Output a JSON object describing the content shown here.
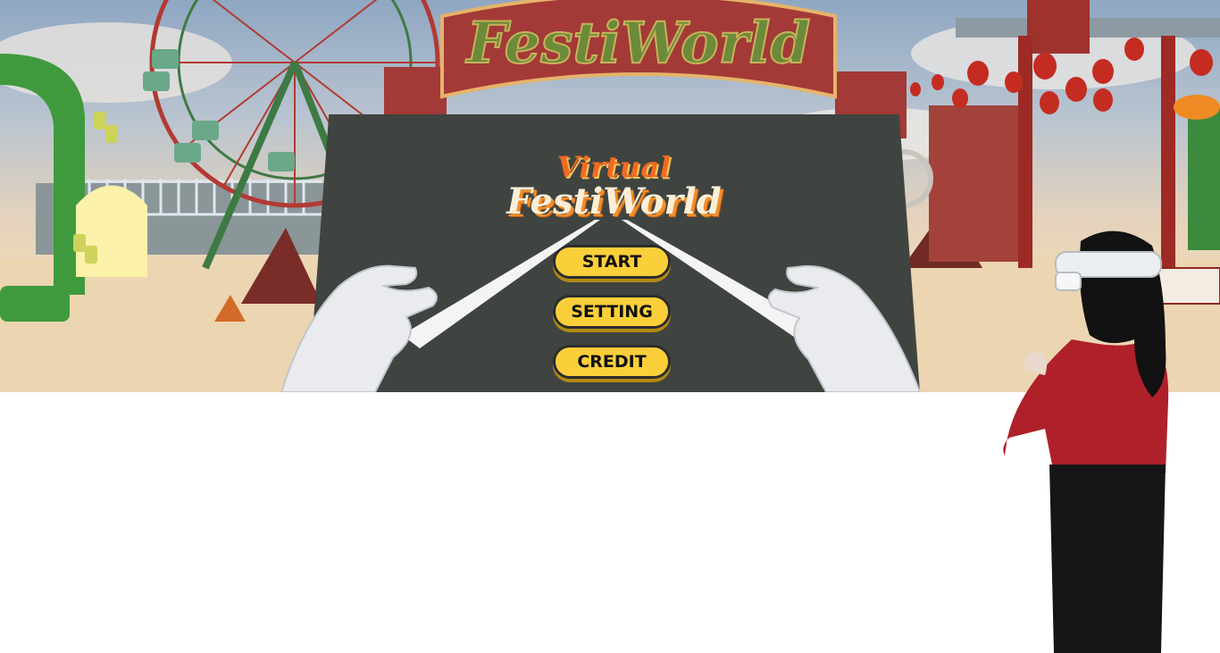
{
  "scene": {
    "arch_sign": "FestiWorld"
  },
  "menu": {
    "logo_top": "Virtual",
    "logo_main": "FestiWorld",
    "buttons": {
      "start": "START",
      "setting": "SETTING",
      "credit": "CREDIT"
    }
  },
  "colors": {
    "board": "#3f4440",
    "button_fill": "#fbcf3a",
    "logo_orange": "#f26a21",
    "logo_cream": "#fbefd8",
    "arch_red": "#a33a37",
    "sign_green": "#6b8a3a"
  }
}
